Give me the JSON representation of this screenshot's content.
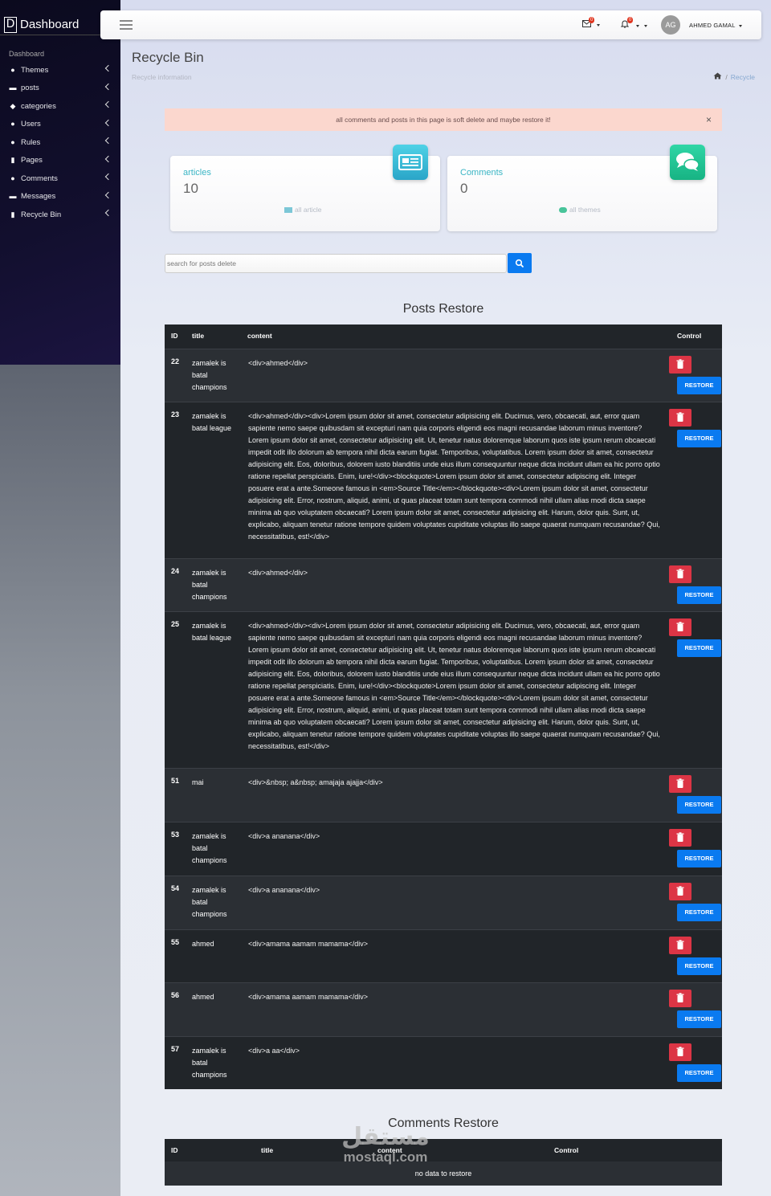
{
  "brand": {
    "logo_letter": "D",
    "name": "Dashboard"
  },
  "sidebar": {
    "section": "Dashboard",
    "items": [
      {
        "label": "Themes",
        "icon": "palette-icon"
      },
      {
        "label": "posts",
        "icon": "post-icon"
      },
      {
        "label": "categories",
        "icon": "tags-icon"
      },
      {
        "label": "Users",
        "icon": "users-icon"
      },
      {
        "label": "Rules",
        "icon": "user-icon"
      },
      {
        "label": "Pages",
        "icon": "file-icon"
      },
      {
        "label": "Comments",
        "icon": "comments-icon"
      },
      {
        "label": "Messages",
        "icon": "id-card-icon"
      },
      {
        "label": "Recycle Bin",
        "icon": "trash-icon"
      }
    ]
  },
  "navbar": {
    "mail_count": "0",
    "bell_count": "0",
    "avatar_initials": "AG",
    "user_name": "AHMED GAMAL"
  },
  "page": {
    "title": "Recycle Bin",
    "subtitle": "Recycle information",
    "breadcrumb_current": "Recycle",
    "breadcrumb_sep": "/"
  },
  "alert": {
    "message": "all comments and posts in this page is soft delete and maybe restore it!",
    "close": "×"
  },
  "cards": [
    {
      "title": "articles",
      "value": "10",
      "footer": "all article"
    },
    {
      "title": "Comments",
      "value": "0",
      "footer": "all themes"
    }
  ],
  "search": {
    "placeholder": "search for posts delete"
  },
  "posts_table": {
    "title": "Posts Restore",
    "headers": {
      "id": "ID",
      "title": "title",
      "content": "content",
      "control": "Control"
    },
    "restore_label": "RESTORE",
    "rows": [
      {
        "id": "22",
        "title": "zamalek is batal champions",
        "content": "<div>ahmed</div>"
      },
      {
        "id": "23",
        "title": "zamalek is batal league",
        "content": "<div>ahmed</div><div>Lorem ipsum dolor sit amet, consectetur adipisicing elit. Ducimus, vero, obcaecati, aut, error quam sapiente nemo saepe quibusdam sit excepturi nam quia corporis eligendi eos magni recusandae laborum minus inventore? Lorem ipsum dolor sit amet, consectetur adipisicing elit. Ut, tenetur natus doloremque laborum quos iste ipsum rerum obcaecati impedit odit illo dolorum ab tempora nihil dicta earum fugiat. Temporibus, voluptatibus. Lorem ipsum dolor sit amet, consectetur adipisicing elit. Eos, doloribus, dolorem iusto blanditiis unde eius illum consequuntur neque dicta incidunt ullam ea hic porro optio ratione repellat perspiciatis. Enim, iure!</div><blockquote>Lorem ipsum dolor sit amet, consectetur adipiscing elit. Integer posuere erat a ante.Someone famous in <em>Source Title</em></blockquote><div>Lorem ipsum dolor sit amet, consectetur adipisicing elit. Error, nostrum, aliquid, animi, ut quas placeat totam sunt tempora commodi nihil ullam alias modi dicta saepe minima ab quo voluptatem obcaecati? Lorem ipsum dolor sit amet, consectetur adipisicing elit. Harum, dolor quis. Sunt, ut, explicabo, aliquam tenetur ratione tempore quidem voluptates cupiditate voluptas illo saepe quaerat numquam recusandae? Qui, necessitatibus, est!</div>"
      },
      {
        "id": "24",
        "title": "zamalek is batal champions",
        "content": "<div>ahmed</div>"
      },
      {
        "id": "25",
        "title": "zamalek is batal league",
        "content": "<div>ahmed</div><div>Lorem ipsum dolor sit amet, consectetur adipisicing elit. Ducimus, vero, obcaecati, aut, error quam sapiente nemo saepe quibusdam sit excepturi nam quia corporis eligendi eos magni recusandae laborum minus inventore? Lorem ipsum dolor sit amet, consectetur adipisicing elit. Ut, tenetur natus doloremque laborum quos iste ipsum rerum obcaecati impedit odit illo dolorum ab tempora nihil dicta earum fugiat. Temporibus, voluptatibus. Lorem ipsum dolor sit amet, consectetur adipisicing elit. Eos, doloribus, dolorem iusto blanditiis unde eius illum consequuntur neque dicta incidunt ullam ea hic porro optio ratione repellat perspiciatis. Enim, iure!</div><blockquote>Lorem ipsum dolor sit amet, consectetur adipiscing elit. Integer posuere erat a ante.Someone famous in <em>Source Title</em></blockquote><div>Lorem ipsum dolor sit amet, consectetur adipisicing elit. Error, nostrum, aliquid, animi, ut quas placeat totam sunt tempora commodi nihil ullam alias modi dicta saepe minima ab quo voluptatem obcaecati? Lorem ipsum dolor sit amet, consectetur adipisicing elit. Harum, dolor quis. Sunt, ut, explicabo, aliquam tenetur ratione tempore quidem voluptates cupiditate voluptas illo saepe quaerat numquam recusandae? Qui, necessitatibus, est!</div>"
      },
      {
        "id": "51",
        "title": "mai",
        "content": "<div>&nbsp; a&nbsp; amajaja ajajja</div>"
      },
      {
        "id": "53",
        "title": "zamalek is batal champions",
        "content": "<div>a ananana</div>"
      },
      {
        "id": "54",
        "title": "zamalek is batal champions",
        "content": "<div>a ananana</div>"
      },
      {
        "id": "55",
        "title": "ahmed",
        "content": "<div>amama aamam mamama</div>"
      },
      {
        "id": "56",
        "title": "ahmed",
        "content": "<div>amama aamam mamama</div>"
      },
      {
        "id": "57",
        "title": "zamalek is batal champions",
        "content": "<div>a aa</div>"
      }
    ]
  },
  "comments_table": {
    "title": "Comments Restore",
    "headers": {
      "id": "ID",
      "title": "title",
      "content": "content",
      "control": "Control"
    },
    "empty": "no data to restore"
  },
  "watermark": {
    "arabic": "مستقل",
    "latin": "mostaql.com"
  },
  "colors": {
    "primary": "#0a7af0",
    "danger": "#dc3545",
    "alert_bg": "#fbd7ce",
    "card_title": "#3ab5c5",
    "table_dark": "#212529"
  }
}
